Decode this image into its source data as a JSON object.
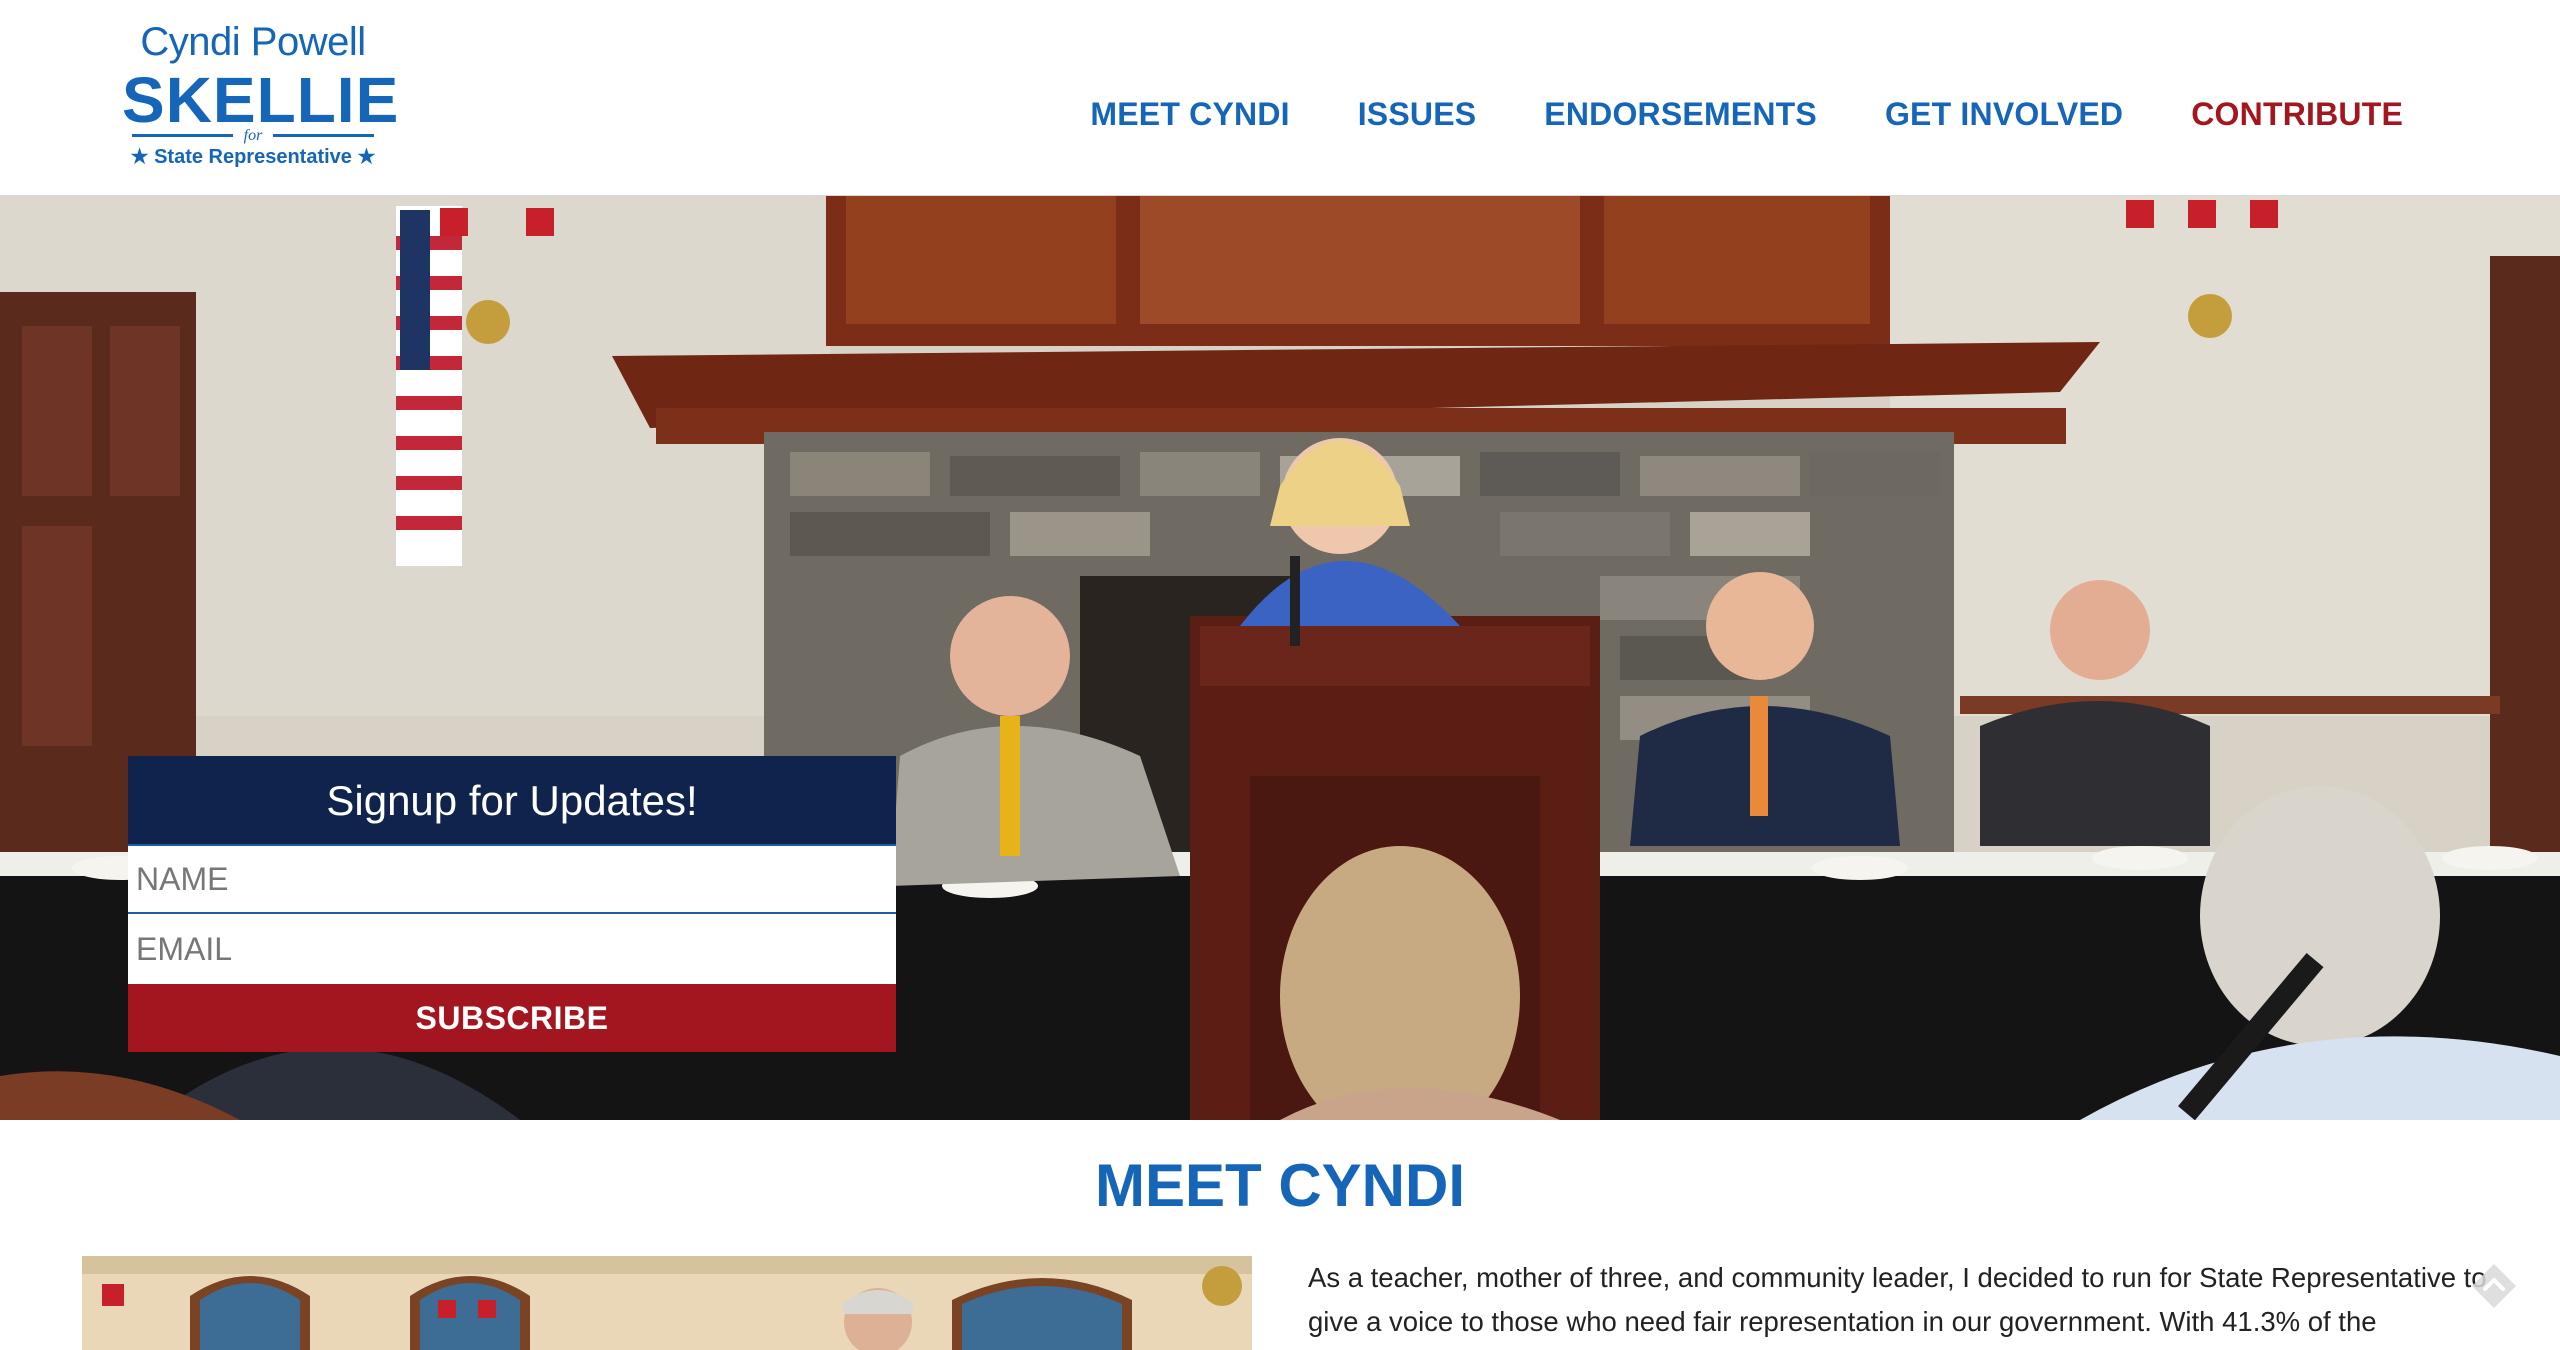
{
  "logo": {
    "line1": "Cyndi Powell",
    "line2": "SKELLIE",
    "for_text": "for",
    "line3": "★ State Representative ★"
  },
  "nav": {
    "items": [
      {
        "label": "MEET CYNDI"
      },
      {
        "label": "ISSUES"
      },
      {
        "label": "ENDORSEMENTS"
      },
      {
        "label": "GET INVOLVED"
      },
      {
        "label": "CONTRIBUTE",
        "color": "#a3161f"
      }
    ]
  },
  "signup": {
    "title": "Signup for Updates!",
    "name_placeholder": "NAME",
    "email_placeholder": "EMAIL",
    "button_label": "SUBSCRIBE"
  },
  "meet": {
    "heading": "MEET CYNDI",
    "text": "As a teacher, mother of three, and community leader, I decided to run for State Representative to give a voice to those who need fair representation in our government. With 41.3% of the"
  },
  "colors": {
    "brand_blue": "#1565b8",
    "navy": "#10234d",
    "accent_red": "#a3161f"
  },
  "icons": {
    "scroll_top": "chevron-up-icon"
  }
}
